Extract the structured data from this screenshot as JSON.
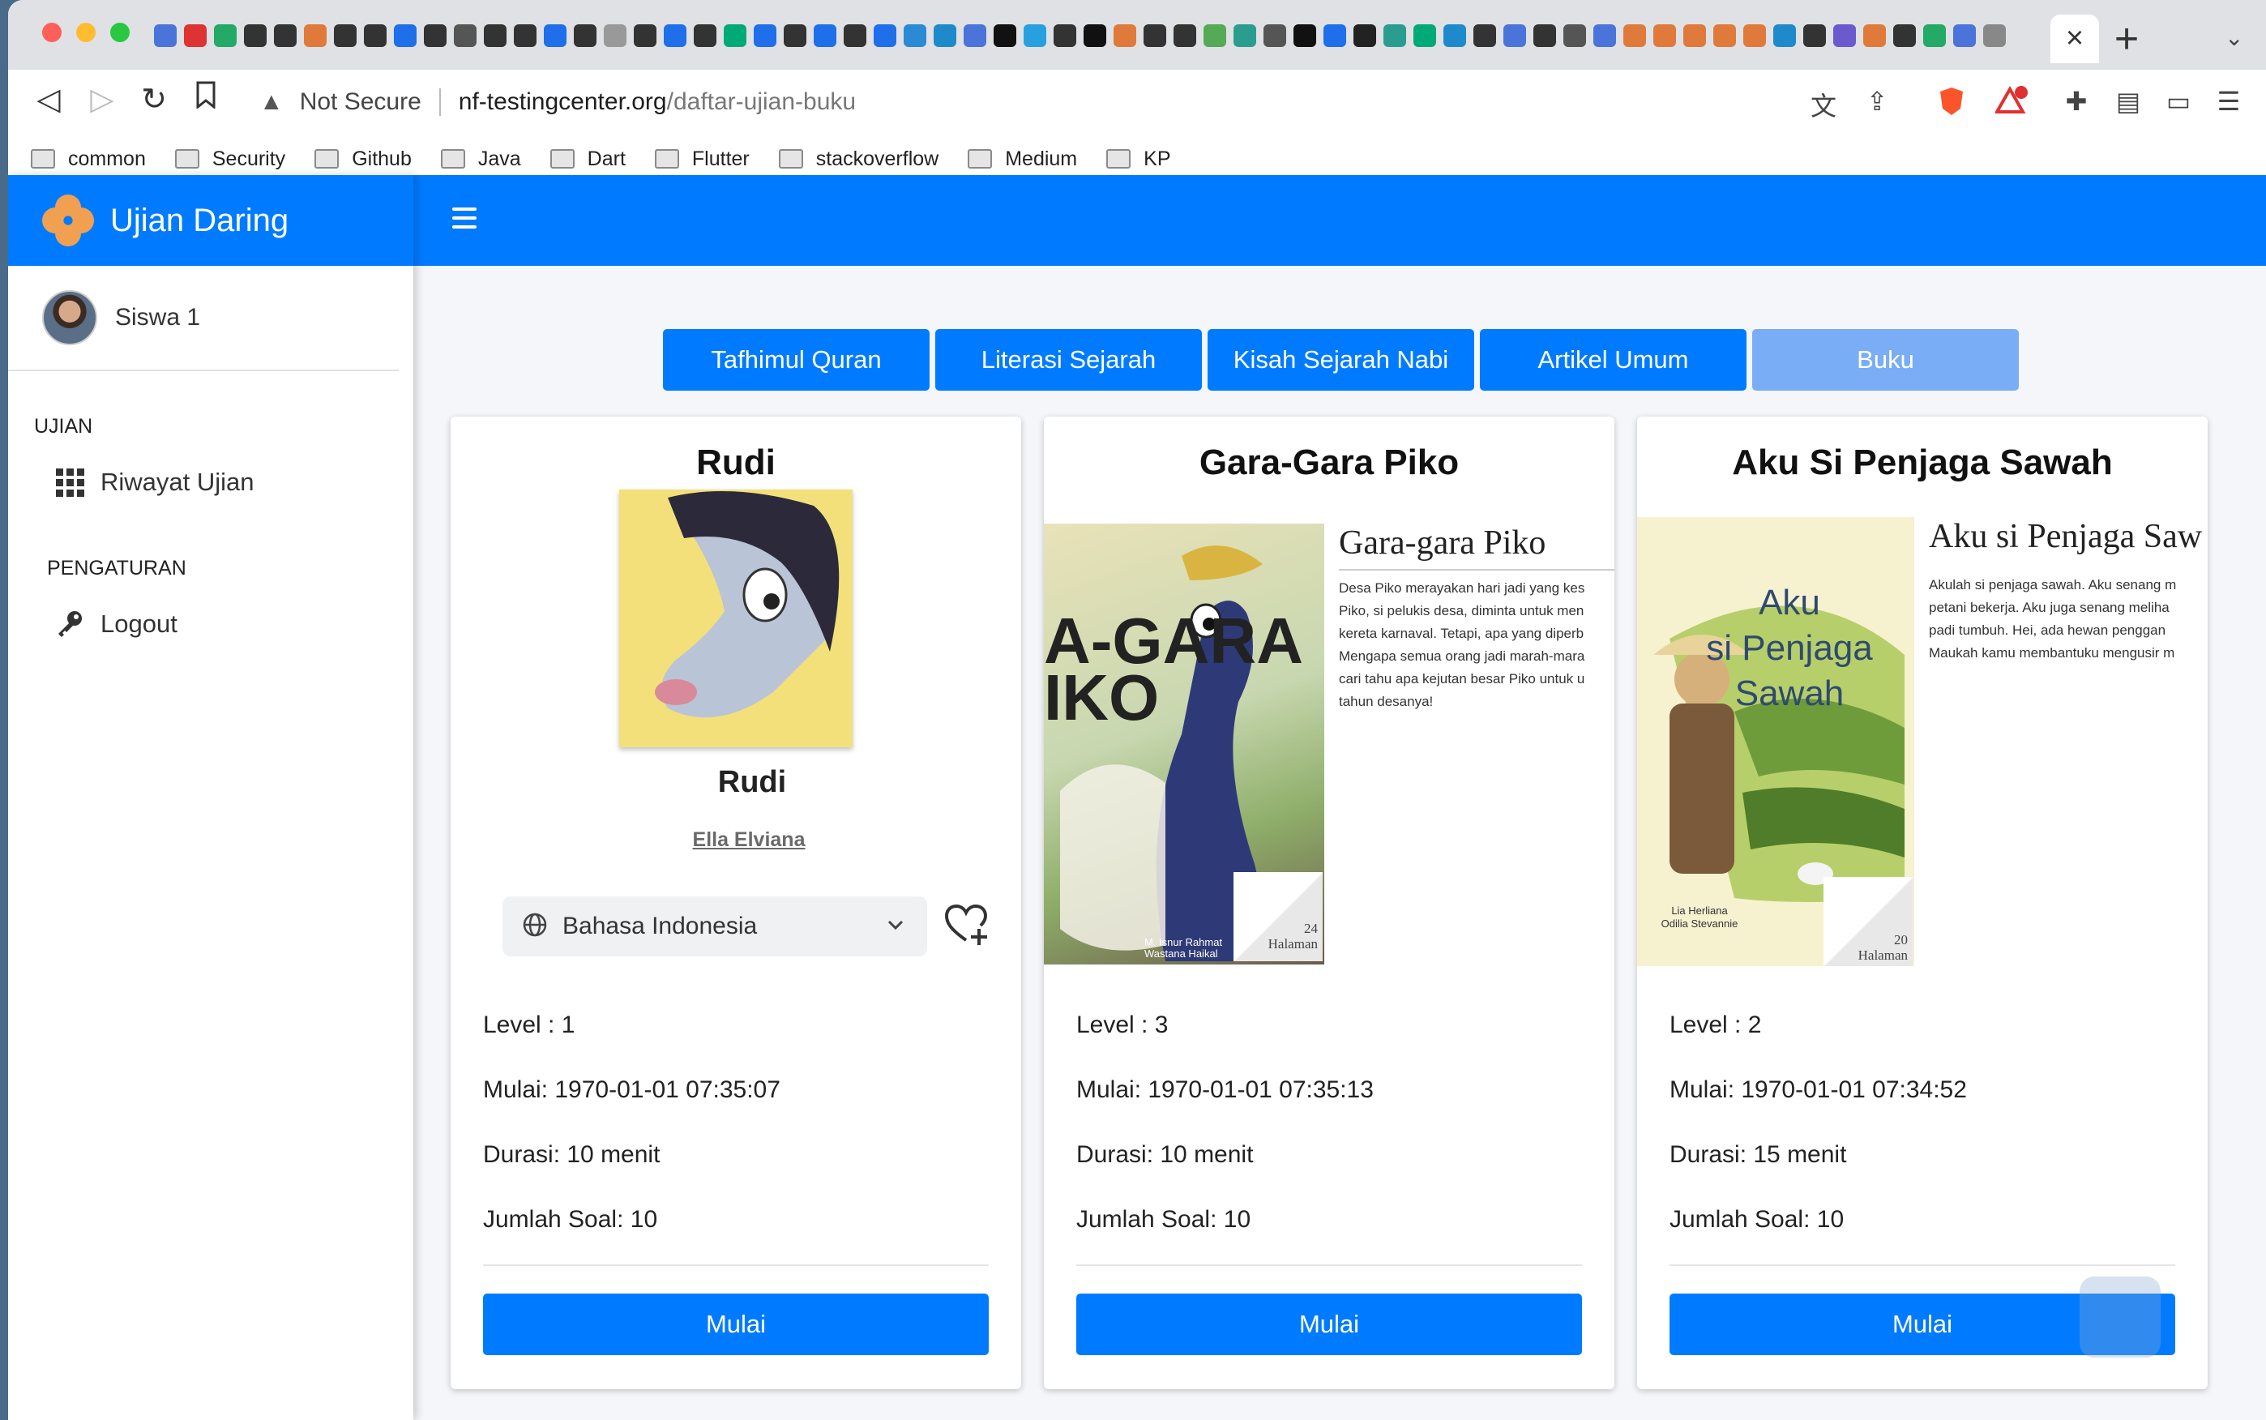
{
  "browser": {
    "not_secure": "Not Secure",
    "url_host": "nf-testingcenter.org",
    "url_path": "/daftar-ujian-buku",
    "bookmarks": [
      "common",
      "Security",
      "Github",
      "Java",
      "Dart",
      "Flutter",
      "stackoverflow",
      "Medium",
      "KP"
    ]
  },
  "app": {
    "brand": "Ujian Daring",
    "user": "Siswa 1",
    "nav": {
      "section_ujian": "UJIAN",
      "riwayat": "Riwayat Ujian",
      "section_pengaturan": "PENGATURAN",
      "logout": "Logout"
    }
  },
  "categories": [
    {
      "label": "Tafhimul Quran",
      "active": false
    },
    {
      "label": "Literasi Sejarah",
      "active": false
    },
    {
      "label": "Kisah Sejarah Nabi",
      "active": false
    },
    {
      "label": "Artikel Umum",
      "active": false
    },
    {
      "label": "Buku",
      "active": true
    }
  ],
  "cards": [
    {
      "title": "Rudi",
      "subtitle": "Rudi",
      "author": "Ella Elviana",
      "language": "Bahasa Indonesia",
      "level": "Level : 1",
      "mulai": "Mulai: 1970-01-01 07:35:07",
      "durasi": "Durasi: 10 menit",
      "jumlah": "Jumlah Soal: 10",
      "button": "Mulai"
    },
    {
      "title": "Gara-Gara Piko",
      "level": "Level : 3",
      "mulai": "Mulai: 1970-01-01 07:35:13",
      "durasi": "Durasi: 10 menit",
      "jumlah": "Jumlah Soal: 10",
      "button": "Mulai",
      "spread": {
        "title": "Gara-gara Piko",
        "cover_text": "A-GARA\nIKO",
        "cover_authors": "M. Isnur Rahmat\nWastana Haikal",
        "text": [
          "Desa Piko merayakan hari jadi yang kes",
          "Piko, si pelukis desa, diminta untuk men",
          "kereta karnaval. Tetapi, apa yang diperb",
          "Mengapa semua orang jadi marah-mara",
          "cari tahu apa kejutan besar Piko untuk u",
          "tahun desanya!"
        ],
        "pages_num": "24",
        "pages_label": "Halaman"
      }
    },
    {
      "title": "Aku Si Penjaga Sawah",
      "level": "Level : 2",
      "mulai": "Mulai: 1970-01-01 07:34:52",
      "durasi": "Durasi: 15 menit",
      "jumlah": "Jumlah Soal: 10",
      "button": "Mulai",
      "spread": {
        "title": "Aku si Penjaga Saw",
        "cover_text": "Aku\nsi Penjaga\nSawah",
        "cover_authors": "Lia Herliana\nOdilia Stevannie",
        "text": [
          "Akulah si penjaga sawah. Aku senang m",
          "petani bekerja. Aku juga senang meliha",
          "padi tumbuh. Hei, ada hewan penggan",
          "Maukah kamu membantuku mengusir m"
        ],
        "pages_num": "20",
        "pages_label": "Halaman"
      }
    }
  ],
  "colors": {
    "primary": "#007bff",
    "active_tab": "#79adf5"
  }
}
